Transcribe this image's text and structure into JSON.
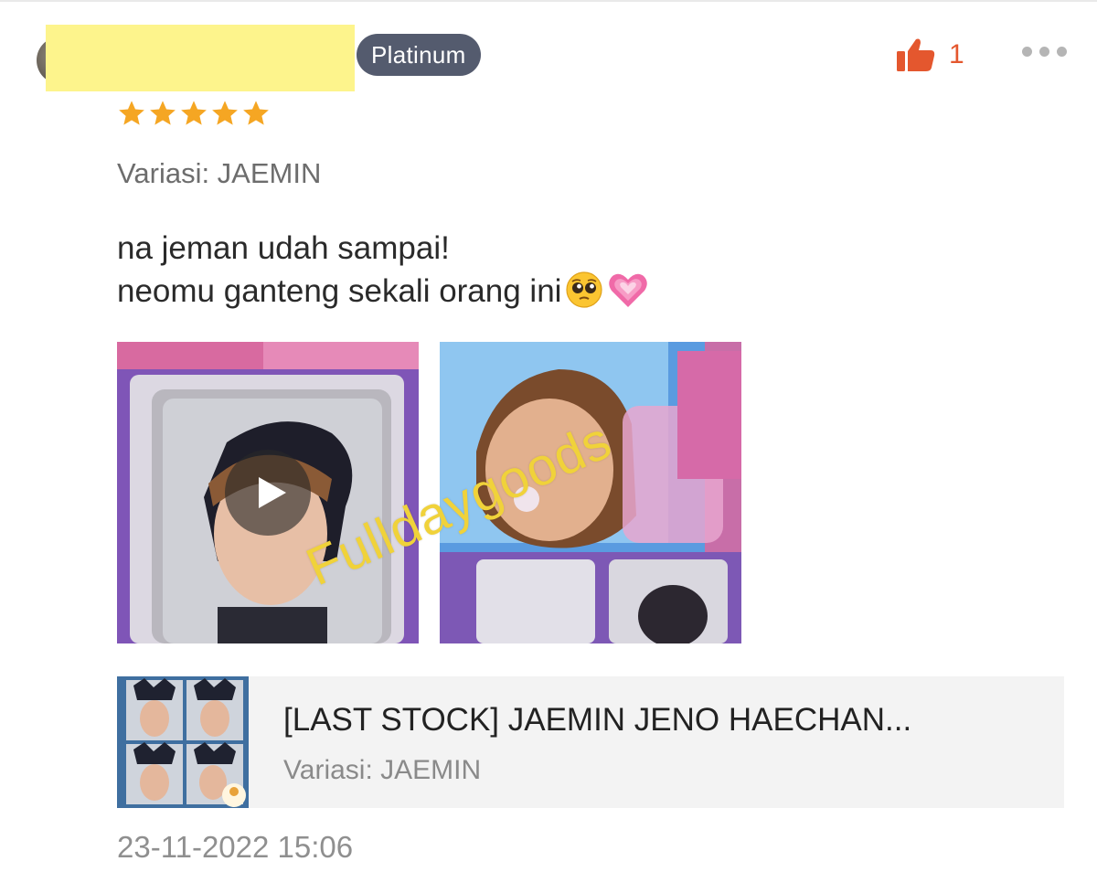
{
  "review": {
    "badge": "Platinum",
    "like_count": "1",
    "rating": 5,
    "variant_label": "Variasi: JAEMIN",
    "text_line1": "na jeman udah sampai!",
    "text_line2": "neomu ganteng sekali orang ini",
    "watermark": "Fulldaygoods",
    "timestamp": "23-11-2022 15:06"
  },
  "product": {
    "title": "[LAST STOCK] JAEMIN JENO HAECHAN...",
    "variant": "Variasi: JAEMIN"
  },
  "colors": {
    "accent": "#e4572e",
    "star": "#f5a623",
    "badge_bg": "#545b6e",
    "watermark": "#f0d23a"
  },
  "icons": [
    "thumbs-up-icon",
    "more-icon",
    "star-icon",
    "play-icon",
    "pleading-face-emoji",
    "growing-heart-emoji"
  ]
}
